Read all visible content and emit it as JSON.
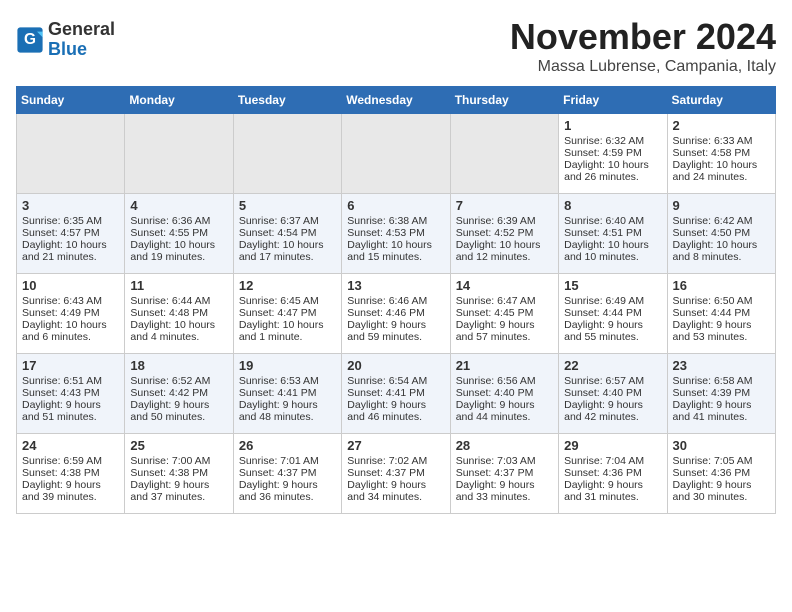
{
  "logo": {
    "text1": "General",
    "text2": "Blue"
  },
  "title": "November 2024",
  "location": "Massa Lubrense, Campania, Italy",
  "days_of_week": [
    "Sunday",
    "Monday",
    "Tuesday",
    "Wednesday",
    "Thursday",
    "Friday",
    "Saturday"
  ],
  "weeks": [
    [
      {
        "day": "",
        "data": ""
      },
      {
        "day": "",
        "data": ""
      },
      {
        "day": "",
        "data": ""
      },
      {
        "day": "",
        "data": ""
      },
      {
        "day": "",
        "data": ""
      },
      {
        "day": "1",
        "data": "Sunrise: 6:32 AM\nSunset: 4:59 PM\nDaylight: 10 hours\nand 26 minutes."
      },
      {
        "day": "2",
        "data": "Sunrise: 6:33 AM\nSunset: 4:58 PM\nDaylight: 10 hours\nand 24 minutes."
      }
    ],
    [
      {
        "day": "3",
        "data": "Sunrise: 6:35 AM\nSunset: 4:57 PM\nDaylight: 10 hours\nand 21 minutes."
      },
      {
        "day": "4",
        "data": "Sunrise: 6:36 AM\nSunset: 4:55 PM\nDaylight: 10 hours\nand 19 minutes."
      },
      {
        "day": "5",
        "data": "Sunrise: 6:37 AM\nSunset: 4:54 PM\nDaylight: 10 hours\nand 17 minutes."
      },
      {
        "day": "6",
        "data": "Sunrise: 6:38 AM\nSunset: 4:53 PM\nDaylight: 10 hours\nand 15 minutes."
      },
      {
        "day": "7",
        "data": "Sunrise: 6:39 AM\nSunset: 4:52 PM\nDaylight: 10 hours\nand 12 minutes."
      },
      {
        "day": "8",
        "data": "Sunrise: 6:40 AM\nSunset: 4:51 PM\nDaylight: 10 hours\nand 10 minutes."
      },
      {
        "day": "9",
        "data": "Sunrise: 6:42 AM\nSunset: 4:50 PM\nDaylight: 10 hours\nand 8 minutes."
      }
    ],
    [
      {
        "day": "10",
        "data": "Sunrise: 6:43 AM\nSunset: 4:49 PM\nDaylight: 10 hours\nand 6 minutes."
      },
      {
        "day": "11",
        "data": "Sunrise: 6:44 AM\nSunset: 4:48 PM\nDaylight: 10 hours\nand 4 minutes."
      },
      {
        "day": "12",
        "data": "Sunrise: 6:45 AM\nSunset: 4:47 PM\nDaylight: 10 hours\nand 1 minute."
      },
      {
        "day": "13",
        "data": "Sunrise: 6:46 AM\nSunset: 4:46 PM\nDaylight: 9 hours\nand 59 minutes."
      },
      {
        "day": "14",
        "data": "Sunrise: 6:47 AM\nSunset: 4:45 PM\nDaylight: 9 hours\nand 57 minutes."
      },
      {
        "day": "15",
        "data": "Sunrise: 6:49 AM\nSunset: 4:44 PM\nDaylight: 9 hours\nand 55 minutes."
      },
      {
        "day": "16",
        "data": "Sunrise: 6:50 AM\nSunset: 4:44 PM\nDaylight: 9 hours\nand 53 minutes."
      }
    ],
    [
      {
        "day": "17",
        "data": "Sunrise: 6:51 AM\nSunset: 4:43 PM\nDaylight: 9 hours\nand 51 minutes."
      },
      {
        "day": "18",
        "data": "Sunrise: 6:52 AM\nSunset: 4:42 PM\nDaylight: 9 hours\nand 50 minutes."
      },
      {
        "day": "19",
        "data": "Sunrise: 6:53 AM\nSunset: 4:41 PM\nDaylight: 9 hours\nand 48 minutes."
      },
      {
        "day": "20",
        "data": "Sunrise: 6:54 AM\nSunset: 4:41 PM\nDaylight: 9 hours\nand 46 minutes."
      },
      {
        "day": "21",
        "data": "Sunrise: 6:56 AM\nSunset: 4:40 PM\nDaylight: 9 hours\nand 44 minutes."
      },
      {
        "day": "22",
        "data": "Sunrise: 6:57 AM\nSunset: 4:40 PM\nDaylight: 9 hours\nand 42 minutes."
      },
      {
        "day": "23",
        "data": "Sunrise: 6:58 AM\nSunset: 4:39 PM\nDaylight: 9 hours\nand 41 minutes."
      }
    ],
    [
      {
        "day": "24",
        "data": "Sunrise: 6:59 AM\nSunset: 4:38 PM\nDaylight: 9 hours\nand 39 minutes."
      },
      {
        "day": "25",
        "data": "Sunrise: 7:00 AM\nSunset: 4:38 PM\nDaylight: 9 hours\nand 37 minutes."
      },
      {
        "day": "26",
        "data": "Sunrise: 7:01 AM\nSunset: 4:37 PM\nDaylight: 9 hours\nand 36 minutes."
      },
      {
        "day": "27",
        "data": "Sunrise: 7:02 AM\nSunset: 4:37 PM\nDaylight: 9 hours\nand 34 minutes."
      },
      {
        "day": "28",
        "data": "Sunrise: 7:03 AM\nSunset: 4:37 PM\nDaylight: 9 hours\nand 33 minutes."
      },
      {
        "day": "29",
        "data": "Sunrise: 7:04 AM\nSunset: 4:36 PM\nDaylight: 9 hours\nand 31 minutes."
      },
      {
        "day": "30",
        "data": "Sunrise: 7:05 AM\nSunset: 4:36 PM\nDaylight: 9 hours\nand 30 minutes."
      }
    ]
  ]
}
